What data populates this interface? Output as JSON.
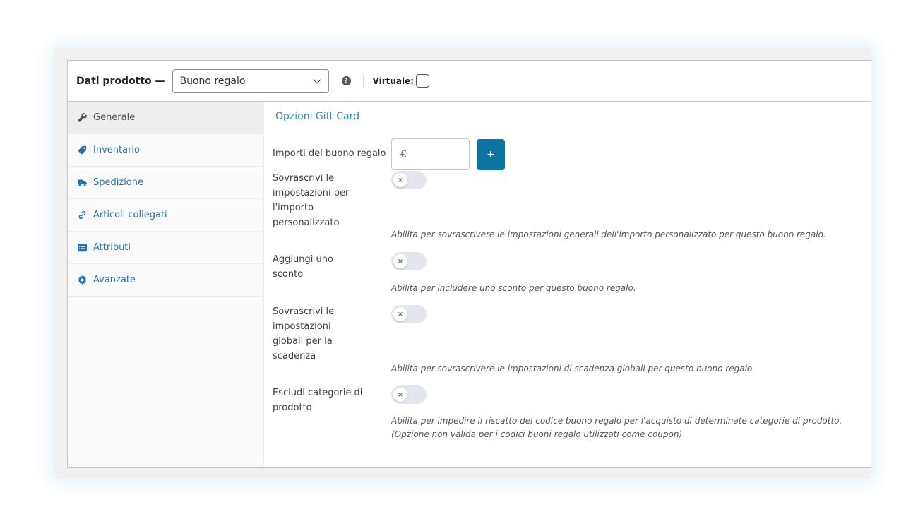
{
  "header": {
    "title": "Dati prodotto —",
    "product_type": "Buono regalo",
    "help_icon": "question-circle-icon",
    "help_glyph": "?",
    "virtual_label": "Virtuale:"
  },
  "sidebar": {
    "items": [
      {
        "label": "Generale",
        "icon": "wrench-icon",
        "active": true
      },
      {
        "label": "Inventario",
        "icon": "tag-icon",
        "active": false
      },
      {
        "label": "Spedizione",
        "icon": "truck-icon",
        "active": false
      },
      {
        "label": "Articoli collegati",
        "icon": "link-icon",
        "active": false
      },
      {
        "label": "Attributi",
        "icon": "list-icon",
        "active": false
      },
      {
        "label": "Avanzate",
        "icon": "gear-icon",
        "active": false
      }
    ]
  },
  "main": {
    "section_title": "Opzioni Gift Card",
    "amounts": {
      "label": "Importi del buono regalo",
      "input_placeholder": "€",
      "add_label": "+"
    },
    "toggle_glyph": "×",
    "options": [
      {
        "label": "Sovrascrivi le impostazioni per l'importo personalizzato",
        "enabled": false,
        "description": "Abilita per sovrascrivere le impostazioni generali dell'importo personalizzato per questo buono regalo."
      },
      {
        "label": "Aggiungi uno sconto",
        "enabled": false,
        "description": "Abilita per includere uno sconto per questo buono regalo."
      },
      {
        "label": "Sovrascrivi le impostazioni globali per la scadenza",
        "enabled": false,
        "description": "Abilita per sovrascrivere le impostazioni di scadenza globali per questo buono regalo."
      },
      {
        "label": "Escludi categorie di prodotto",
        "enabled": false,
        "description": "Abilita per impedire il riscatto del codice buono regalo per l'acquisto di determinate categorie di prodotto.",
        "description_note": "(Opzione non valida per i codici buoni regalo utilizzati come coupon)"
      }
    ]
  },
  "colors": {
    "accent": "#0d73a0",
    "link": "#2271b1",
    "section_title": "#2e8ab1",
    "toggle_off": "#e3e6ef"
  }
}
